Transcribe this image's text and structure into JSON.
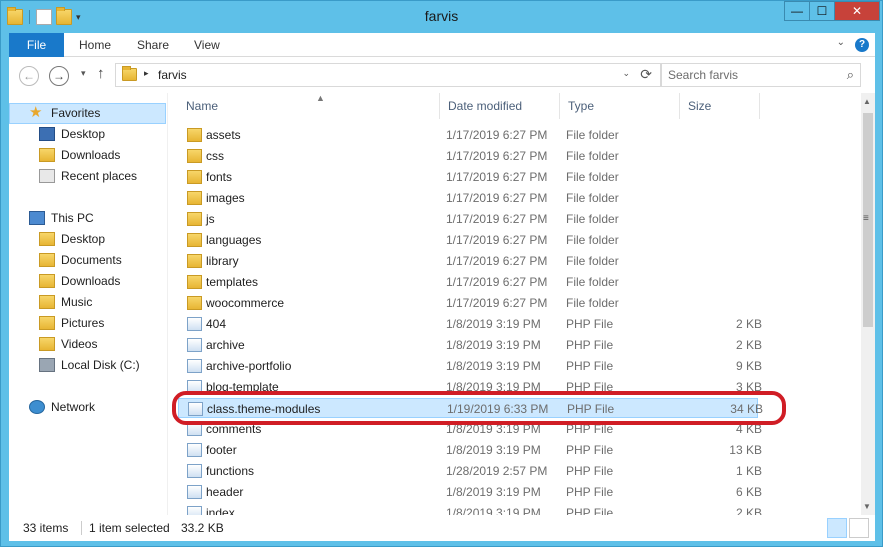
{
  "window": {
    "title": "farvis"
  },
  "controls": {
    "minimize": "—",
    "maximize": "☐",
    "close": "✕"
  },
  "ribbon": {
    "file": "File",
    "home": "Home",
    "share": "Share",
    "view": "View",
    "help": "?"
  },
  "address": {
    "path": "farvis",
    "search_placeholder": "Search farvis"
  },
  "nav": {
    "favorites": "Favorites",
    "desktop": "Desktop",
    "downloads": "Downloads",
    "recent": "Recent places",
    "thispc": "This PC",
    "pc_desktop": "Desktop",
    "pc_documents": "Documents",
    "pc_downloads": "Downloads",
    "pc_music": "Music",
    "pc_pictures": "Pictures",
    "pc_videos": "Videos",
    "pc_disk": "Local Disk (C:)",
    "network": "Network"
  },
  "columns": {
    "name": "Name",
    "date": "Date modified",
    "type": "Type",
    "size": "Size"
  },
  "files": [
    {
      "name": "assets",
      "date": "1/17/2019 6:27 PM",
      "type": "File folder",
      "size": "",
      "kind": "folder"
    },
    {
      "name": "css",
      "date": "1/17/2019 6:27 PM",
      "type": "File folder",
      "size": "",
      "kind": "folder"
    },
    {
      "name": "fonts",
      "date": "1/17/2019 6:27 PM",
      "type": "File folder",
      "size": "",
      "kind": "folder"
    },
    {
      "name": "images",
      "date": "1/17/2019 6:27 PM",
      "type": "File folder",
      "size": "",
      "kind": "folder"
    },
    {
      "name": "js",
      "date": "1/17/2019 6:27 PM",
      "type": "File folder",
      "size": "",
      "kind": "folder"
    },
    {
      "name": "languages",
      "date": "1/17/2019 6:27 PM",
      "type": "File folder",
      "size": "",
      "kind": "folder"
    },
    {
      "name": "library",
      "date": "1/17/2019 6:27 PM",
      "type": "File folder",
      "size": "",
      "kind": "folder"
    },
    {
      "name": "templates",
      "date": "1/17/2019 6:27 PM",
      "type": "File folder",
      "size": "",
      "kind": "folder"
    },
    {
      "name": "woocommerce",
      "date": "1/17/2019 6:27 PM",
      "type": "File folder",
      "size": "",
      "kind": "folder"
    },
    {
      "name": "404",
      "date": "1/8/2019 3:19 PM",
      "type": "PHP File",
      "size": "2 KB",
      "kind": "php"
    },
    {
      "name": "archive",
      "date": "1/8/2019 3:19 PM",
      "type": "PHP File",
      "size": "2 KB",
      "kind": "php"
    },
    {
      "name": "archive-portfolio",
      "date": "1/8/2019 3:19 PM",
      "type": "PHP File",
      "size": "9 KB",
      "kind": "php"
    },
    {
      "name": "blog-template",
      "date": "1/8/2019 3:19 PM",
      "type": "PHP File",
      "size": "3 KB",
      "kind": "php"
    },
    {
      "name": "class.theme-modules",
      "date": "1/19/2019 6:33 PM",
      "type": "PHP File",
      "size": "34 KB",
      "kind": "php",
      "selected": true
    },
    {
      "name": "comments",
      "date": "1/8/2019 3:19 PM",
      "type": "PHP File",
      "size": "4 KB",
      "kind": "php"
    },
    {
      "name": "footer",
      "date": "1/8/2019 3:19 PM",
      "type": "PHP File",
      "size": "13 KB",
      "kind": "php"
    },
    {
      "name": "functions",
      "date": "1/28/2019 2:57 PM",
      "type": "PHP File",
      "size": "1 KB",
      "kind": "php"
    },
    {
      "name": "header",
      "date": "1/8/2019 3:19 PM",
      "type": "PHP File",
      "size": "6 KB",
      "kind": "php"
    },
    {
      "name": "index",
      "date": "1/8/2019 3:19 PM",
      "type": "PHP File",
      "size": "2 KB",
      "kind": "php"
    }
  ],
  "status": {
    "items": "33 items",
    "selected": "1 item selected",
    "size": "33.2 KB"
  },
  "colors": {
    "highlight": "#d01d25",
    "selection": "#cce8ff",
    "file_tab": "#1979ca"
  }
}
